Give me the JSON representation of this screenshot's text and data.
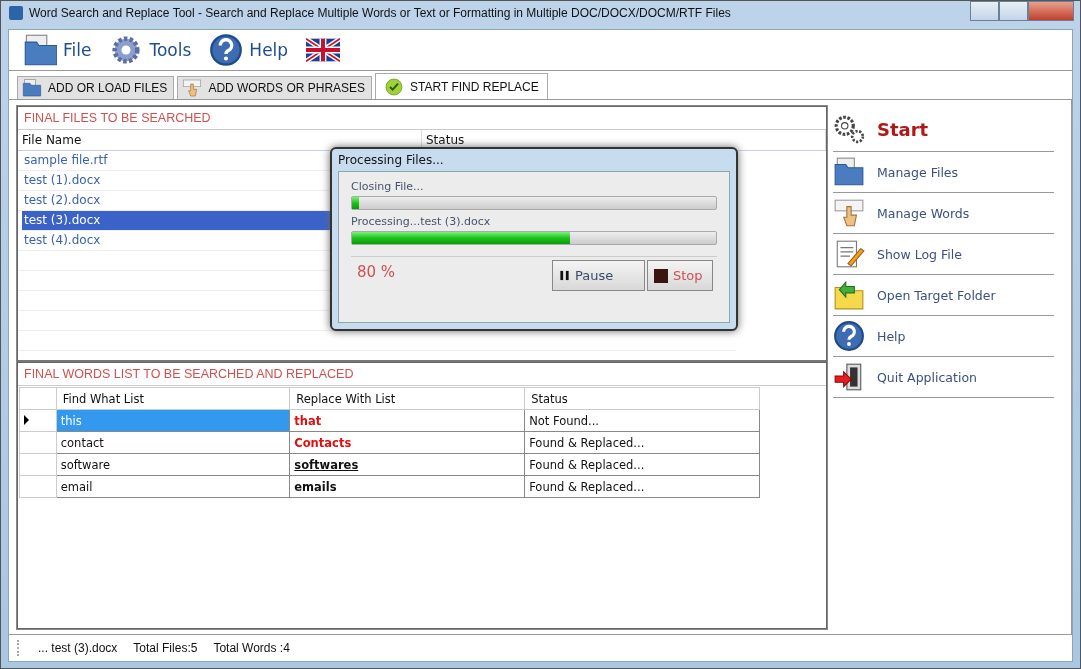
{
  "window": {
    "title": "Word Search and Replace Tool - Search and Replace Multiple Words or Text  or Formatting in Multiple DOC/DOCX/DOCM/RTF Files"
  },
  "menu": [
    {
      "label": "File",
      "kind": "file"
    },
    {
      "label": "Tools",
      "kind": "tools"
    },
    {
      "label": "Help",
      "kind": "help"
    },
    {
      "kind": "flag"
    }
  ],
  "tabs": [
    {
      "label": "ADD OR LOAD FILES",
      "kind": "files",
      "selected": false
    },
    {
      "label": "ADD WORDS OR PHRASES",
      "kind": "words",
      "selected": false
    },
    {
      "label": "START FIND REPLACE",
      "kind": "check",
      "selected": true
    }
  ],
  "files_panel": {
    "title": "FINAL FILES TO BE SEARCHED",
    "columns": [
      "File Name",
      "Status"
    ],
    "rows": [
      {
        "name": "sample file.rtf",
        "selected": false
      },
      {
        "name": "test (1).docx",
        "selected": false
      },
      {
        "name": "test (2).docx",
        "selected": false
      },
      {
        "name": "test (3).docx",
        "selected": true
      },
      {
        "name": "test (4).docx",
        "selected": false
      }
    ]
  },
  "words_panel": {
    "title": "FINAL WORDS LIST TO BE SEARCHED AND REPLACED",
    "columns": [
      "Find What List",
      "Replace With List",
      "Status"
    ],
    "rows": [
      {
        "find": "this",
        "replace": "that",
        "kind": "red",
        "status": "Not Found...",
        "selected": true
      },
      {
        "find": "contact",
        "replace": "Contacts",
        "kind": "red",
        "status": "Found & Replaced...",
        "selected": false
      },
      {
        "find": "software",
        "replace": "softwares",
        "kind": "underline",
        "status": "Found & Replaced...",
        "selected": false
      },
      {
        "find": "email",
        "replace": "emails",
        "kind": "bold",
        "status": "Found & Replaced...",
        "selected": false
      }
    ]
  },
  "dialog": {
    "title": "Processing Files...",
    "bars": [
      {
        "label": "Closing File...",
        "level": 0.02
      },
      {
        "label": "Processing...test (3).docx",
        "level": 0.6
      }
    ],
    "percent": "80 %",
    "buttons": [
      {
        "label": "Pause",
        "kind": "pause"
      },
      {
        "label": "Stop",
        "kind": "stop"
      }
    ]
  },
  "sidebar": {
    "items": [
      {
        "label": "Start",
        "kind": "start"
      },
      {
        "label": "Manage Files",
        "kind": "files"
      },
      {
        "label": "Manage Words",
        "kind": "words"
      },
      {
        "label": "Show Log File",
        "kind": "log"
      },
      {
        "label": "Open Target Folder",
        "kind": "folder"
      },
      {
        "label": "Help",
        "kind": "help"
      },
      {
        "label": "Quit Application",
        "kind": "quit"
      }
    ]
  },
  "status_bar": [
    "... test (3).docx",
    "Total Files:5",
    "Total Words :4"
  ]
}
